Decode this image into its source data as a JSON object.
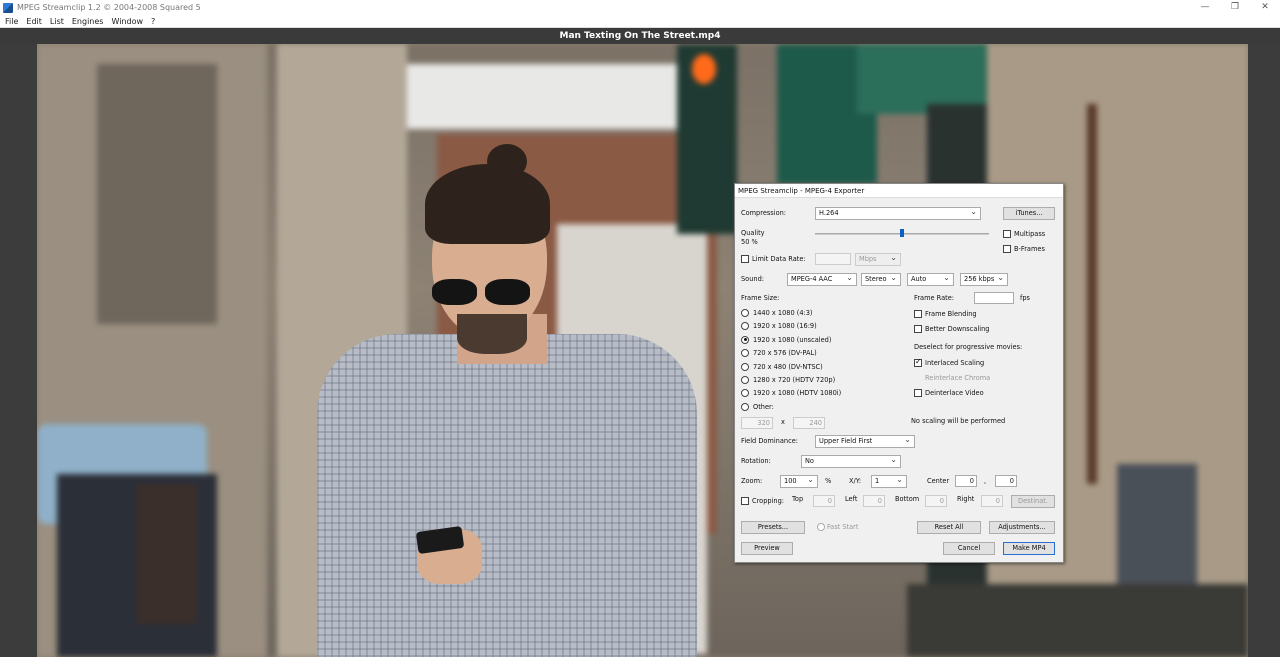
{
  "window": {
    "title": "MPEG Streamclip 1.2  © 2004-2008 Squared 5",
    "controls": [
      "—",
      "❐",
      "✕"
    ]
  },
  "menu": [
    "File",
    "Edit",
    "List",
    "Engines",
    "Window",
    "?"
  ],
  "movie_title": "Man Texting On The Street.mp4",
  "dialog": {
    "title": "MPEG Streamclip - MPEG-4 Exporter",
    "compression_label": "Compression:",
    "compression_value": "H.264",
    "itunes_button": "iTunes...",
    "quality_label": "Quality",
    "quality_value": "50 %",
    "quality_level": 0.5,
    "multipass_label": "Multipass",
    "bframes_label": "B-Frames",
    "limit_data_rate_label": "Limit Data Rate:",
    "data_rate_unit": "Mbps",
    "sound_label": "Sound:",
    "sound_codec": "MPEG-4 AAC",
    "sound_channels": "Stereo",
    "sound_rate": "Auto",
    "sound_bitrate": "256 kbps",
    "frame_size_label": "Frame Size:",
    "frame_sizes": [
      {
        "label": "1440 x 1080  (4:3)",
        "selected": false
      },
      {
        "label": "1920 x 1080  (16:9)",
        "selected": false
      },
      {
        "label": "1920 x 1080  (unscaled)",
        "selected": true
      },
      {
        "label": "720 x 576  (DV-PAL)",
        "selected": false
      },
      {
        "label": "720 x 480  (DV-NTSC)",
        "selected": false
      },
      {
        "label": "1280 x 720  (HDTV 720p)",
        "selected": false
      },
      {
        "label": "1920 x 1080  (HDTV 1080i)",
        "selected": false
      },
      {
        "label": "Other:",
        "selected": false
      }
    ],
    "other_width": "320",
    "other_x": "x",
    "other_height": "240",
    "frame_rate_label": "Frame Rate:",
    "frame_rate_unit": "fps",
    "frame_blending_label": "Frame Blending",
    "better_downscaling_label": "Better Downscaling",
    "deselect_label": "Deselect for progressive movies:",
    "interlaced_scaling_label": "Interlaced Scaling",
    "reinterlace_chroma_label": "Reinterlace Chroma",
    "deinterlace_video_label": "Deinterlace Video",
    "no_scaling_text": "No scaling will be performed",
    "field_dominance_label": "Field Dominance:",
    "field_dominance_value": "Upper Field First",
    "rotation_label": "Rotation:",
    "rotation_value": "No",
    "zoom_label": "Zoom:",
    "zoom_value": "100",
    "zoom_unit": "%",
    "xy_label": "X/Y:",
    "xy_value": "1",
    "center_label": "Center",
    "center_x": "0",
    "center_sep": ",",
    "center_y": "0",
    "cropping_label": "Cropping:",
    "crop_top_label": "Top",
    "crop_top": "0",
    "crop_left_label": "Left",
    "crop_left": "0",
    "crop_bottom_label": "Bottom",
    "crop_bottom": "0",
    "crop_right_label": "Right",
    "crop_right": "0",
    "destination_button": "Destinat.",
    "presets_button": "Presets...",
    "fast_start_label": "Fast Start",
    "reset_all_button": "Reset All",
    "adjustments_button": "Adjustments...",
    "preview_button": "Preview",
    "cancel_button": "Cancel",
    "make_mp4_button": "Make MP4"
  }
}
